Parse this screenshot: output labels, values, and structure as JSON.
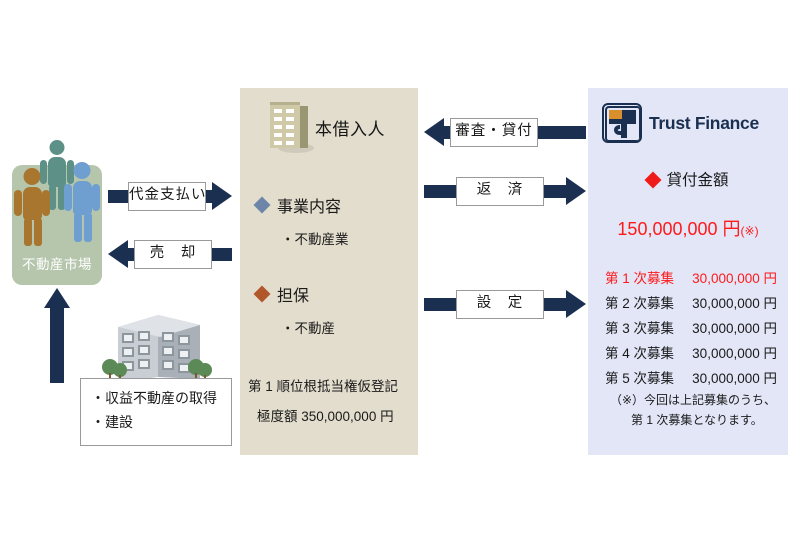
{
  "left": {
    "market": {
      "label": "不動産市場",
      "bg": "#b5c6ac",
      "people_icon": "three-people-icon",
      "person_colors": [
        "#5d9086",
        "#a8762e",
        "#6f9fd1"
      ]
    },
    "acquisition_box": {
      "items": [
        "・収益不動産の取得",
        "・建設"
      ]
    },
    "property_icon": "apartment-building-icon",
    "up_arrow_icon": "arrow-up-icon"
  },
  "arrows": {
    "payment": {
      "label": "代金支払い",
      "direction": "right"
    },
    "sale": {
      "label": "売　却",
      "direction": "left"
    },
    "review_loan": {
      "label": "審査・貸付",
      "direction": "left"
    },
    "repayment": {
      "label": "返　済",
      "direction": "right"
    },
    "setting": {
      "label": "設　定",
      "direction": "right"
    },
    "color": "#1b3050"
  },
  "center": {
    "bg": "#e3ddcd",
    "title": "本借入人",
    "building_icon": "office-building-icon",
    "business": {
      "heading": "事業内容",
      "diamond_color": "#6d86a8",
      "items": [
        "・不動産業"
      ]
    },
    "collateral": {
      "heading": "担保",
      "diamond_color": "#b1572c",
      "items": [
        "・不動産"
      ]
    },
    "notes": [
      "第 1 順位根抵当権仮登記",
      "極度額 350,000,000 円"
    ]
  },
  "right": {
    "bg": "#e2e6f7",
    "logo_icon": "trust-finance-logo-icon",
    "brand": "Trust Finance",
    "loan_heading": "貸付金額",
    "loan_heading_diamond": "#ef1b1b",
    "loan_amount": "150,000,000 円",
    "loan_amount_note": "(※)",
    "loan_amount_color": "#ff1a1a",
    "tranches": [
      {
        "name": "第 1 次募集",
        "amount": "30,000,000 円",
        "highlight": true
      },
      {
        "name": "第 2 次募集",
        "amount": "30,000,000 円",
        "highlight": false
      },
      {
        "name": "第 3 次募集",
        "amount": "30,000,000 円",
        "highlight": false
      },
      {
        "name": "第 4 次募集",
        "amount": "30,000,000 円",
        "highlight": false
      },
      {
        "name": "第 5 次募集",
        "amount": "30,000,000 円",
        "highlight": false
      }
    ],
    "footnote_line1": "（※）今回は上記募集のうち、",
    "footnote_line2": "第 1 次募集となります。"
  }
}
